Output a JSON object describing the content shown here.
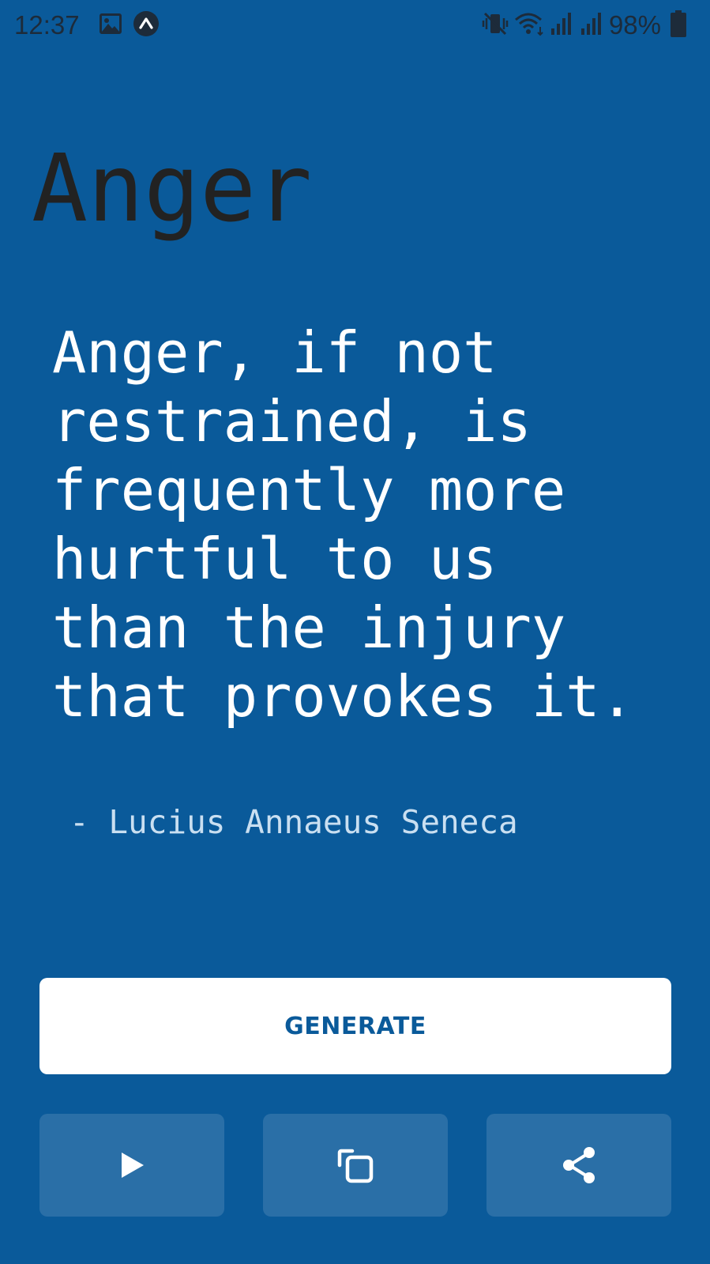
{
  "status_bar": {
    "time": "12:37",
    "battery": "98%",
    "icons": [
      "image-icon",
      "app-notification-icon",
      "vibrate-icon",
      "wifi-icon",
      "signal-icon",
      "signal-icon",
      "battery-icon"
    ]
  },
  "topic": {
    "title": "Anger"
  },
  "quote": {
    "text": "Anger, if not\nrestrained, is\nfrequently more\nhurtful to us\nthan the injury\nthat provokes it.",
    "author": "- Lucius Annaeus Seneca"
  },
  "actions": {
    "generate_label": "GENERATE",
    "play_icon": "play-icon",
    "copy_icon": "copy-icon",
    "share_icon": "share-icon"
  },
  "colors": {
    "background": "#0a5a9a",
    "accent_text": "#0a5a9a",
    "secondary_button": "#2a6fa7",
    "title": "#222222",
    "author": "#c9dff1"
  }
}
